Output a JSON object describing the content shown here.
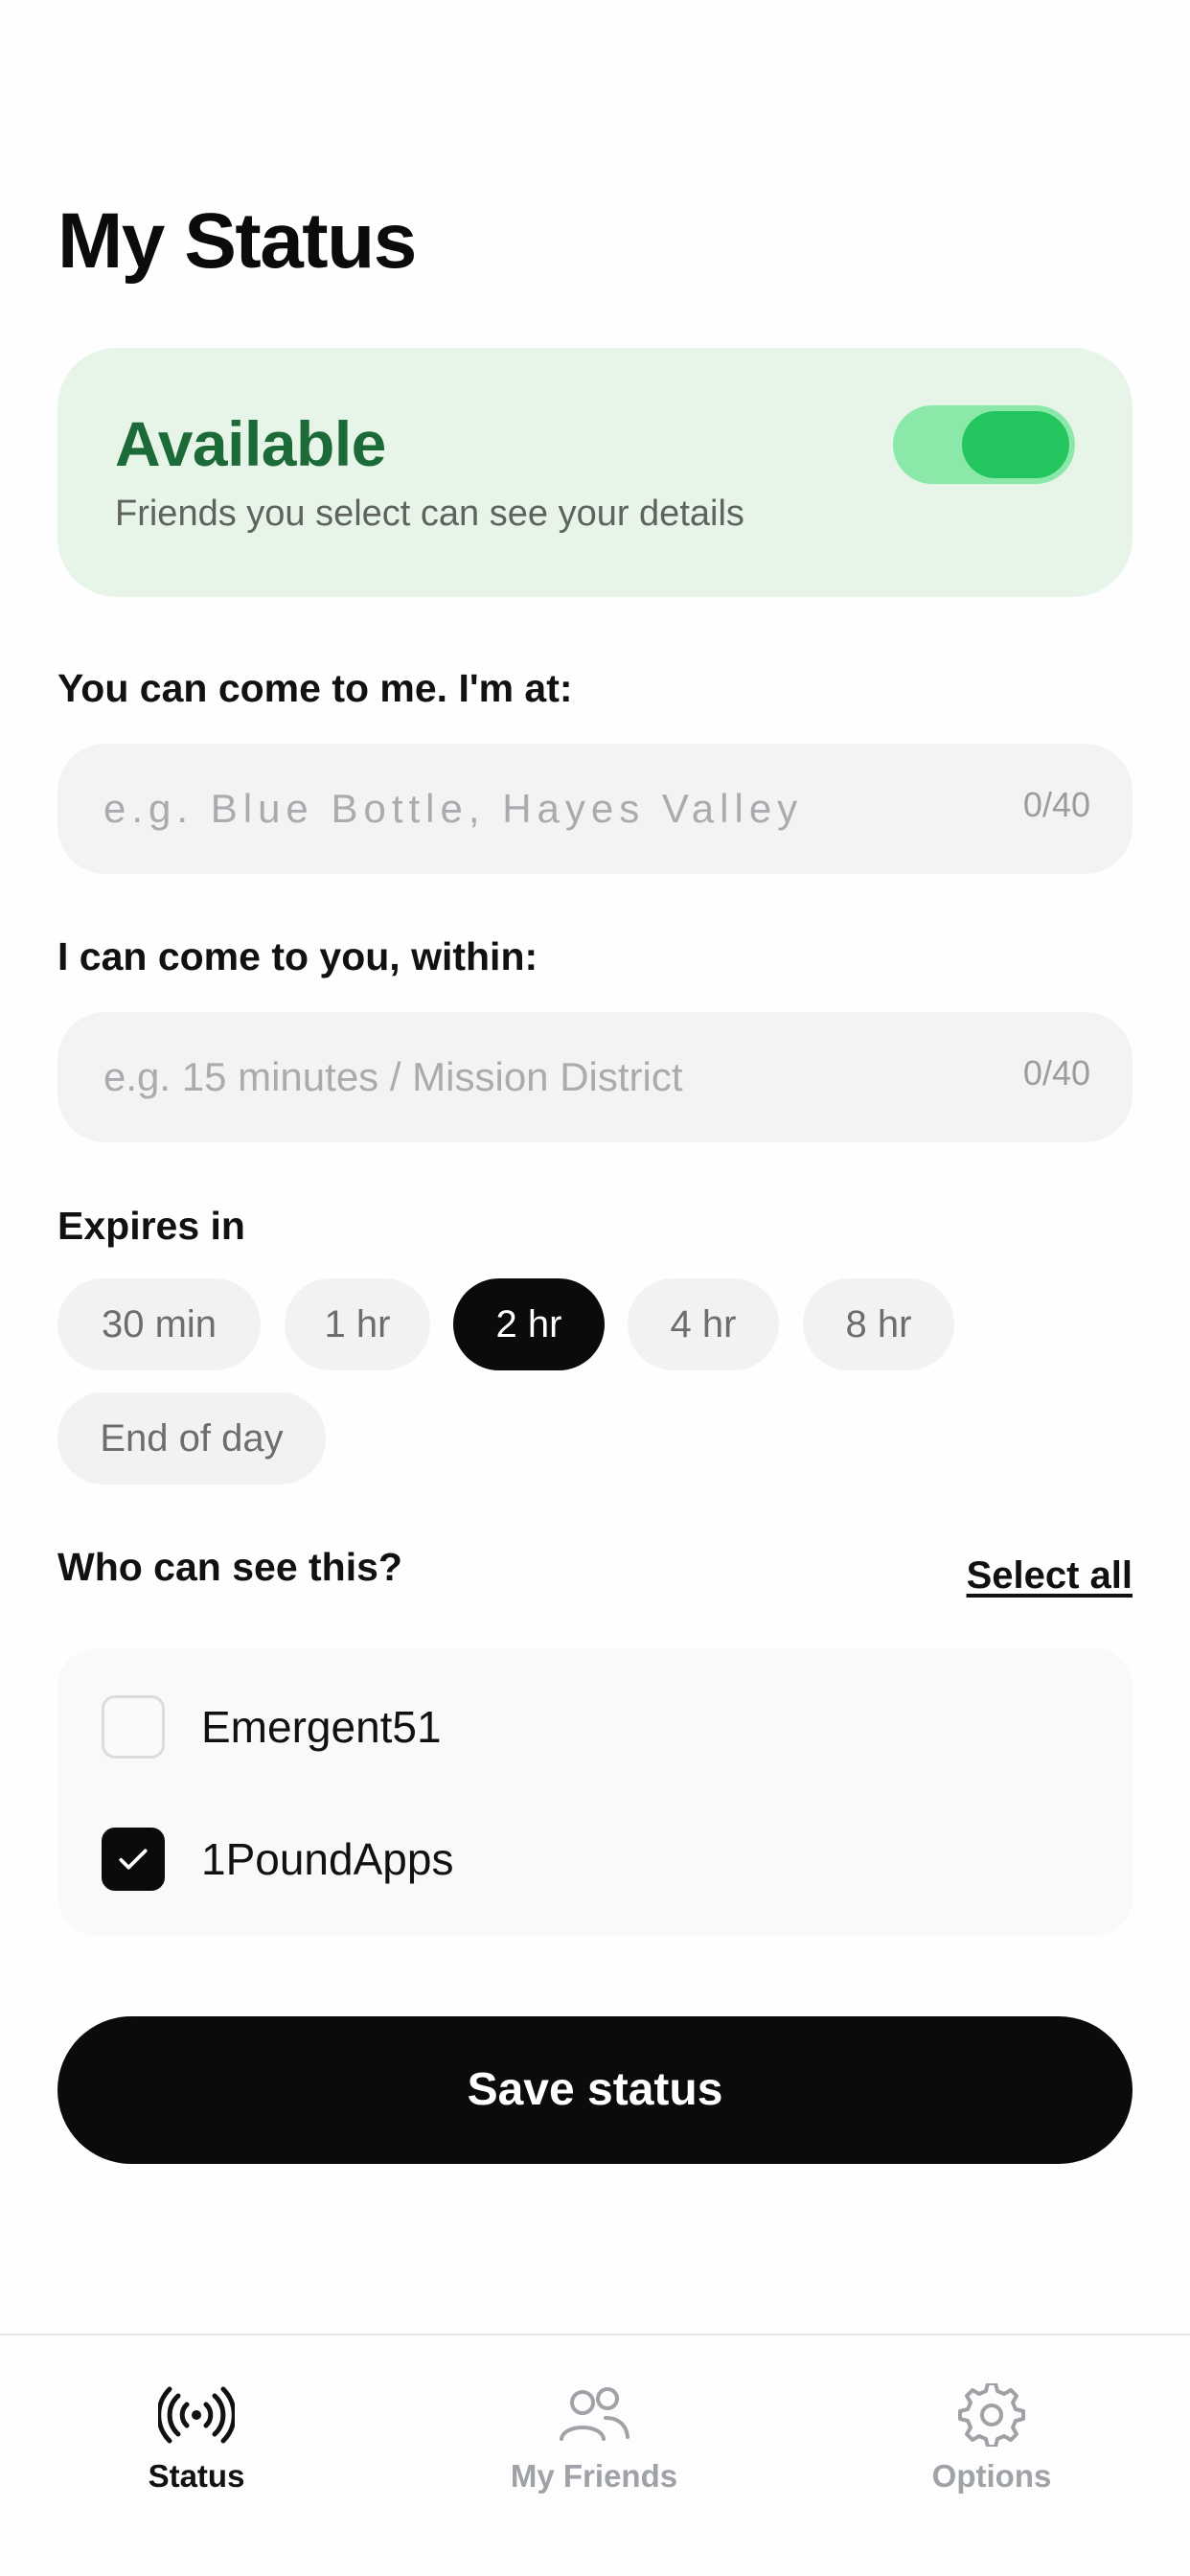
{
  "header": {
    "title": "My Status"
  },
  "status_card": {
    "title": "Available",
    "subtitle": "Friends you select can see your details",
    "toggle_on": true,
    "accent": "#22c55e",
    "background": "#e6f5e8"
  },
  "location": {
    "label": "You can come to me. I'm at:",
    "placeholder": "e.g. Blue Bottle, Hayes Valley",
    "value": "",
    "counter": "0/40"
  },
  "travel": {
    "label": "I can come to you, within:",
    "placeholder": "e.g. 15 minutes / Mission District",
    "value": "",
    "counter": "0/40"
  },
  "expires": {
    "label": "Expires in",
    "options": [
      "30 min",
      "1 hr",
      "2 hr",
      "4 hr",
      "8 hr",
      "End of day"
    ],
    "selected": "2 hr"
  },
  "visibility": {
    "label": "Who can see this?",
    "select_all": "Select all",
    "friends": [
      {
        "name": "Emergent51",
        "checked": false
      },
      {
        "name": "1PoundApps",
        "checked": true
      }
    ]
  },
  "save_button": "Save status",
  "tabbar": {
    "tabs": [
      {
        "label": "Status",
        "icon": "broadcast-icon",
        "active": true
      },
      {
        "label": "My Friends",
        "icon": "people-icon",
        "active": false
      },
      {
        "label": "Options",
        "icon": "gear-icon",
        "active": false
      }
    ]
  }
}
